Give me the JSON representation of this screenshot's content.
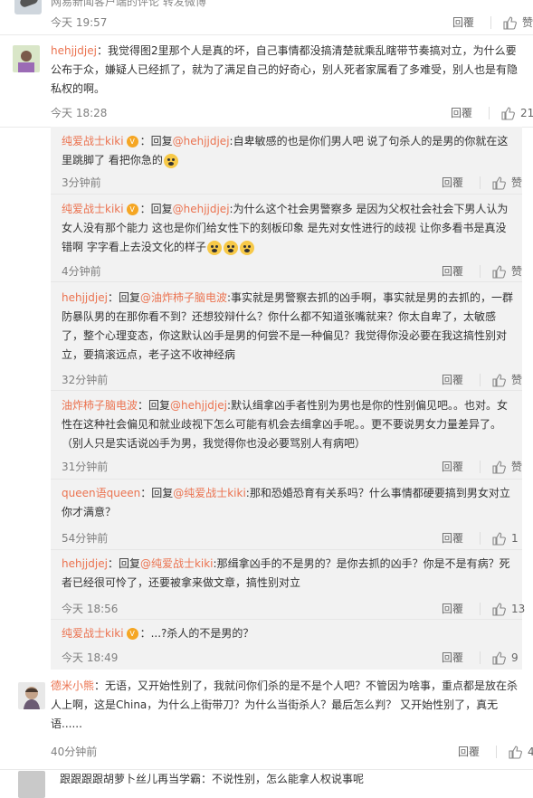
{
  "top_cut": {
    "text": "网易新闻客户端的评论  转发微博",
    "time": "今天 19:57",
    "reply": "回覆",
    "like": "赞"
  },
  "comments": [
    {
      "user": "hehjjdjej",
      "text": "：我觉得图2里那个人是真的坏，自己事情都没搞清楚就乘乱瞎带节奏搞对立，为什么要公布于众，嫌疑人已经抓了，就为了满足自己的好奇心，别人死者家属看了多难受，别人也是有隐私权的啊。",
      "time": "今天 18:28",
      "reply": "回覆",
      "like": "21"
    }
  ],
  "subs": [
    {
      "user": "纯爱战士kiki",
      "vip": "V",
      "mention": "@hehjjdjej",
      "text": ":自卑敏感的也是你们男人吧 说了句杀人的是男的你就在这里跳脚了 看把你急的",
      "time": "3分钟前",
      "reply": "回覆",
      "like": "赞"
    },
    {
      "user": "纯爱战士kiki",
      "vip": "V",
      "mention": "@hehjjdjej",
      "text": ":为什么这个社会男警察多 是因为父权社会社会下男人认为女人没有那个能力 这也是你们给女性下的刻板印象 是先对女性进行的歧视 让你多看书是真没错啊 字字看上去没文化的样子",
      "time": "4分钟前",
      "reply": "回覆",
      "like": "赞"
    },
    {
      "user": "hehjjdjej",
      "mention": "@油炸柿子脑电波",
      "text": ":事实就是男警察去抓的凶手啊，事实就是男的去抓的，一群防暴队男的在那你看不到？还想狡辩什么？你什么都不知道张嘴就来？你太自卑了，太敏感了，整个心理变态，你这默认凶手是男的何尝不是一种偏见？我觉得你没必要在我这搞性别对立，要搞滚远点，老子这不收神经病",
      "time": "32分钟前",
      "reply": "回覆",
      "like": "赞"
    },
    {
      "user": "油炸柿子脑电波",
      "mention": "@hehjjdjej",
      "text": ":默认缉拿凶手者性别为男也是你的性别偏见吧。。也对。女性在这种社会偏见和就业歧视下怎么可能有机会去缉拿凶手呢。。更不要说男女力量差异了。（别人只是实话说凶手为男，我觉得你也没必要骂别人有病吧）",
      "time": "31分钟前",
      "reply": "回覆",
      "like": "赞"
    },
    {
      "user": "queen语queen",
      "mention": "@纯爱战士kiki",
      "text": ":那和恐婚恐育有关系吗？什么事情都硬要搞到男女对立你才满意？",
      "time": "54分钟前",
      "reply": "回覆",
      "like": "1"
    },
    {
      "user": "hehjjdjej",
      "mention": "@纯爱战士kiki",
      "text": ":那缉拿凶手的不是男的？是你去抓的凶手？你是不是有病？死者已经很可怜了，还要被拿来做文章，搞性别对立",
      "time": "今天 18:56",
      "reply": "回覆",
      "like": "13"
    },
    {
      "user": "纯爱战士kiki",
      "vip": "V",
      "mention": "",
      "text": "：...?杀人的不是男的？",
      "time": "今天 18:49",
      "reply": "回覆",
      "like": "9"
    }
  ],
  "comment2": {
    "user": "德米小熊",
    "text": "：无语，又开始性别了，我就问你们杀的是不是个人吧？不管因为啥事，重点都是放在杀人上啊，这是China，为什么上街带刀？为什么当街杀人？最后怎么判？ 又开始性别了，真无语......",
    "time": "40分钟前",
    "reply": "回覆",
    "like": "4"
  },
  "bottom_cut": {
    "text": "跟跟跟跟胡萝卜丝儿再当学霸：不说性别，怎么能拿人权说事呢"
  },
  "reply_label_prefix": "：回复"
}
